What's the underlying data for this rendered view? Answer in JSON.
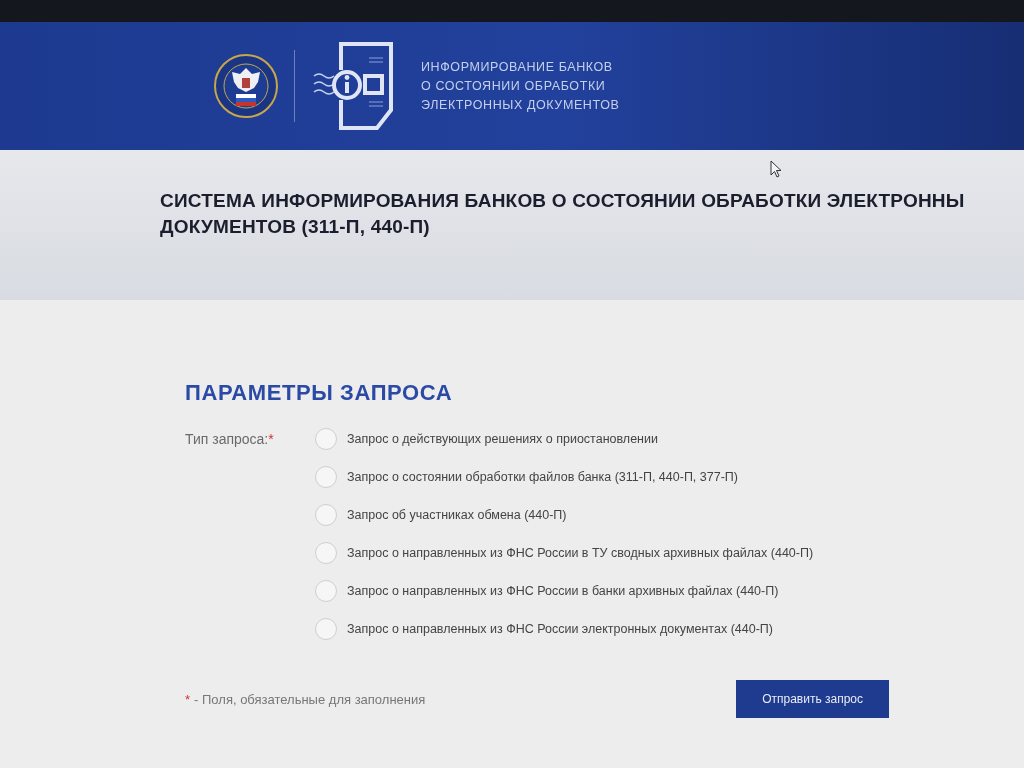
{
  "header": {
    "caption_lines": [
      "ИНФОРМИРОВАНИЕ БАНКОВ",
      "О СОСТОЯНИИ ОБРАБОТКИ",
      "ЭЛЕКТРОННЫХ ДОКУМЕНТОВ"
    ]
  },
  "title_lines": [
    "СИСТЕМА ИНФОРМИРОВАНИЯ БАНКОВ О СОСТОЯНИИ ОБРАБОТКИ ЭЛЕКТРОННЫ",
    "ДОКУМЕНТОВ (311-П, 440-П)"
  ],
  "form": {
    "heading": "ПАРАМЕТРЫ ЗАПРОСА",
    "field_label": "Тип запроса:",
    "required_mark": "*",
    "options": [
      {
        "label": "Запрос о действующих решениях о приостановлении",
        "selected": false
      },
      {
        "label": "Запрос о состоянии обработки файлов банка (311-П, 440-П, 377-П)",
        "selected": false
      },
      {
        "label": "Запрос об участниках обмена (440-П)",
        "selected": false
      },
      {
        "label": "Запрос о направленных из ФНС России в ТУ сводных архивных файлах (440-П)",
        "selected": false
      },
      {
        "label": "Запрос о направленных из ФНС России в банки архивных файлах (440-П)",
        "selected": false
      },
      {
        "label": "Запрос о направленных из ФНС России электронных документах (440-П)",
        "selected": false
      }
    ]
  },
  "footnote": {
    "mark": "*",
    "text": "- Поля, обязательные для заполнения"
  },
  "submit_button": "Отправить запрос"
}
